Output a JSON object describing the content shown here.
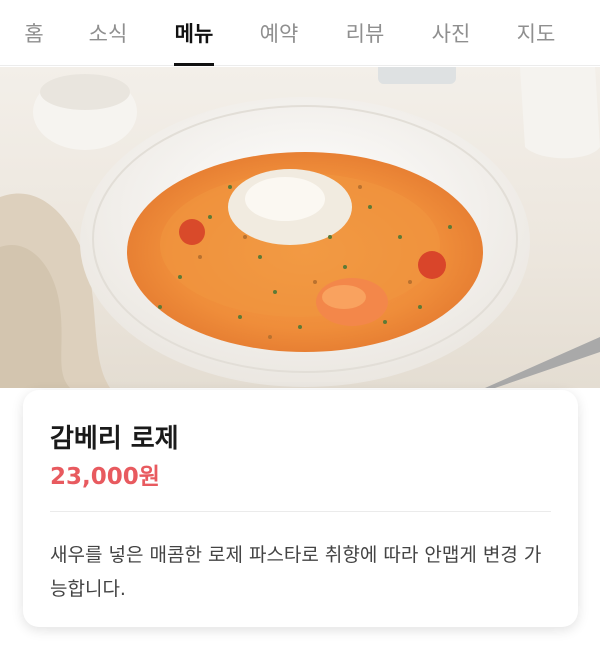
{
  "tabs": [
    {
      "label": "홈"
    },
    {
      "label": "소식"
    },
    {
      "label": "메뉴",
      "active": true
    },
    {
      "label": "예약"
    },
    {
      "label": "리뷰"
    },
    {
      "label": "사진"
    },
    {
      "label": "지도"
    }
  ],
  "menu_item": {
    "name": "감베리 로제",
    "price": "23,000원",
    "description": "새우를 넣은 매콤한 로제 파스타로 취향에 따라 안맵게 변경 가능합니다."
  },
  "colors": {
    "price": "#e85a5f",
    "active_tab": "#111111",
    "inactive_tab": "#8f8f8f"
  }
}
